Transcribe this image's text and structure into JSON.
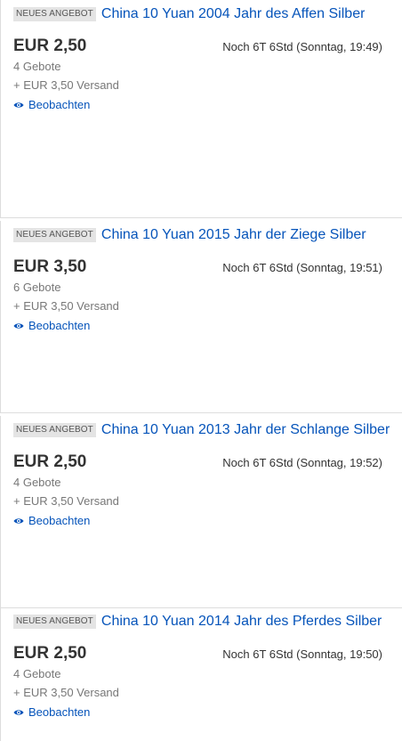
{
  "listings": [
    {
      "badge": "NEUES ANGEBOT",
      "title": "China 10 Yuan 2004 Jahr des Affen Silber",
      "price": "EUR 2,50",
      "time_left": "Noch 6T 6Std (Sonntag, 19:49)",
      "bids": "4 Gebote",
      "shipping": "+ EUR 3,50 Versand",
      "watch_label": "Beobachten"
    },
    {
      "badge": "NEUES ANGEBOT",
      "title": "China 10 Yuan 2015 Jahr der Ziege Silber",
      "price": "EUR 3,50",
      "time_left": "Noch 6T 6Std (Sonntag, 19:51)",
      "bids": "6 Gebote",
      "shipping": "+ EUR 3,50 Versand",
      "watch_label": "Beobachten"
    },
    {
      "badge": "NEUES ANGEBOT",
      "title": "China 10 Yuan 2013 Jahr der Schlange Silber",
      "price": "EUR 2,50",
      "time_left": "Noch 6T 6Std (Sonntag, 19:52)",
      "bids": "4 Gebote",
      "shipping": "+ EUR 3,50 Versand",
      "watch_label": "Beobachten"
    },
    {
      "badge": "NEUES ANGEBOT",
      "title": "China 10 Yuan 2014 Jahr des Pferdes Silber",
      "price": "EUR 2,50",
      "time_left": "Noch 6T 6Std (Sonntag, 19:50)",
      "bids": "4 Gebote",
      "shipping": "+ EUR 3,50 Versand",
      "watch_label": "Beobachten"
    }
  ],
  "colors": {
    "link": "#0654ba",
    "badge_bg": "#e4e4e4",
    "muted_text": "#777777",
    "primary_text": "#333333",
    "divider": "#dddddd"
  },
  "icons": {
    "watch": "eye-icon"
  }
}
